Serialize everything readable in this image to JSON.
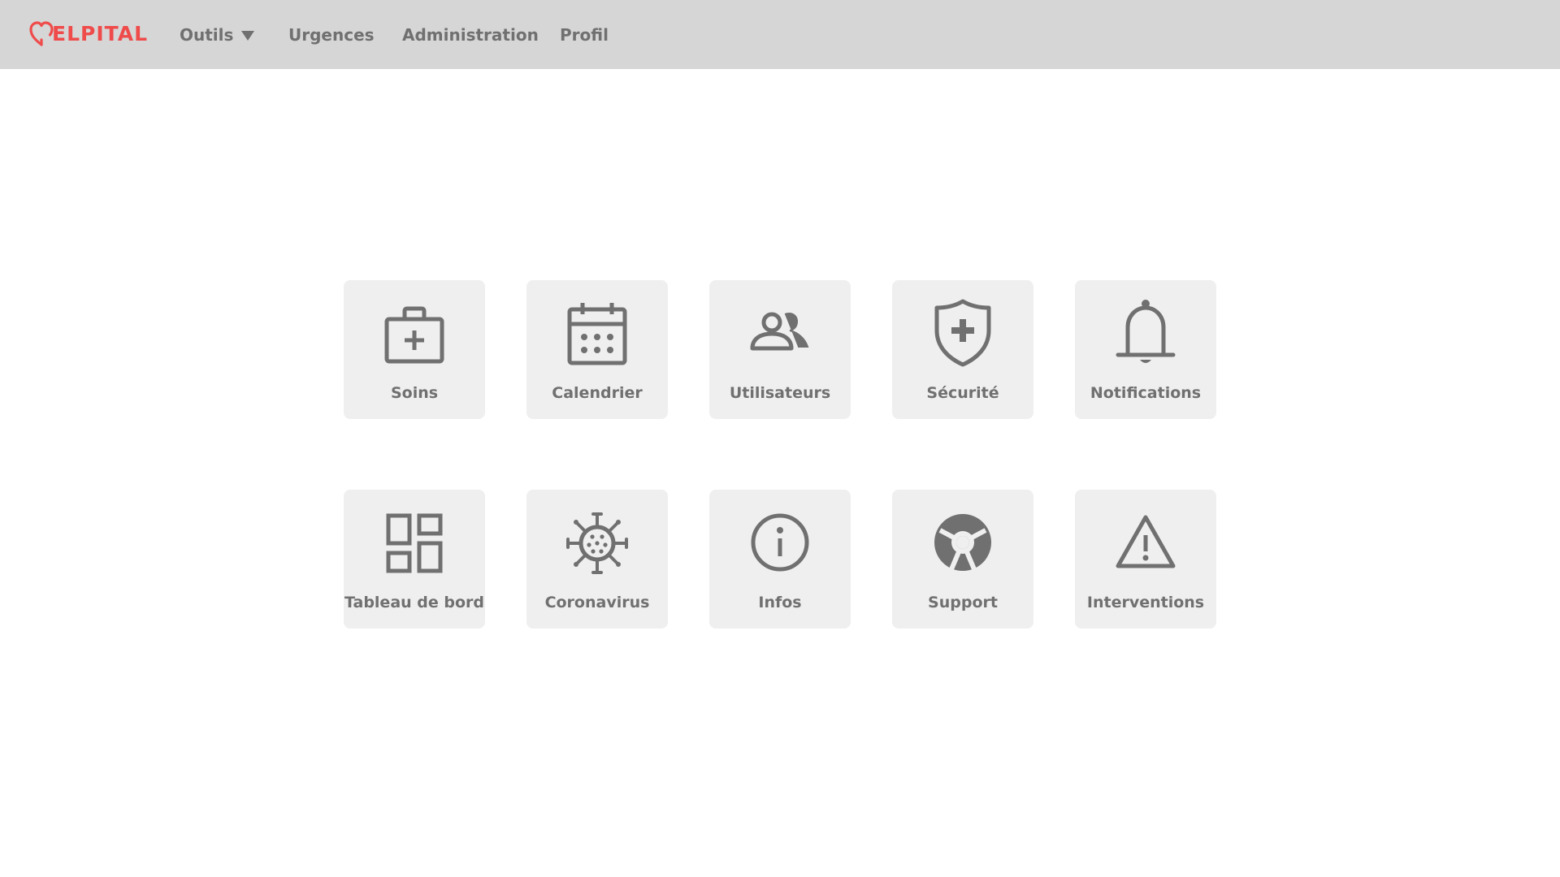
{
  "app": {
    "logo_text": "ELPITAL",
    "logo_icon": "heart-icon",
    "brand_color": "#ef4b4b"
  },
  "nav": {
    "items": [
      {
        "label": "Outils",
        "has_dropdown": true
      },
      {
        "label": "Urgences"
      },
      {
        "label": "Administration"
      },
      {
        "label": "Profil"
      }
    ]
  },
  "tiles": [
    {
      "label": "Soins",
      "icon": "medical-kit-icon"
    },
    {
      "label": "Calendrier",
      "icon": "calendar-icon"
    },
    {
      "label": "Utilisateurs",
      "icon": "users-icon"
    },
    {
      "label": "Sécurité",
      "icon": "shield-plus-icon"
    },
    {
      "label": "Notifications",
      "icon": "bell-icon"
    },
    {
      "label": "Tableau de bord",
      "icon": "dashboard-icon"
    },
    {
      "label": "Coronavirus",
      "icon": "virus-icon"
    },
    {
      "label": "Infos",
      "icon": "info-icon"
    },
    {
      "label": "Support",
      "icon": "lifebuoy-icon"
    },
    {
      "label": "Interventions",
      "icon": "warning-icon"
    }
  ],
  "colors": {
    "navbar_bg": "#d6d6d6",
    "tile_bg": "#efefef",
    "icon_text": "#707070"
  }
}
